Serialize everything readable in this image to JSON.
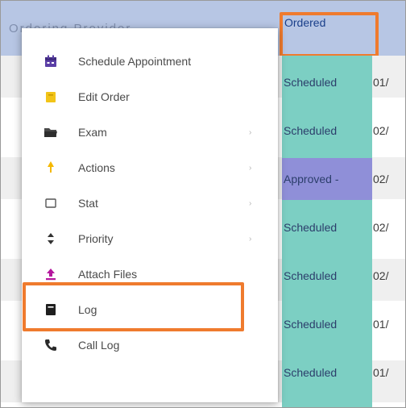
{
  "table": {
    "header_left_text": "Ordering Provider",
    "header_ordered": "Ordered",
    "rows": [
      {
        "status": "Scheduled",
        "date": "01/"
      },
      {
        "status": "Scheduled",
        "date": "02/"
      },
      {
        "status": "Approved - ",
        "date": "02/"
      },
      {
        "status": "Scheduled",
        "date": "02/"
      },
      {
        "status": "Scheduled",
        "date": "02/"
      },
      {
        "status": "Scheduled",
        "date": "01/"
      },
      {
        "status": "Scheduled",
        "date": "01/"
      }
    ]
  },
  "menu": {
    "items": [
      {
        "label": "Schedule Appointment",
        "icon": "calendar-icon",
        "has_submenu": false
      },
      {
        "label": "Edit Order",
        "icon": "folder-icon",
        "has_submenu": false
      },
      {
        "label": "Exam",
        "icon": "folder-open-icon",
        "has_submenu": true
      },
      {
        "label": "Actions",
        "icon": "lightbulb-icon",
        "has_submenu": true
      },
      {
        "label": "Stat",
        "icon": "square-icon",
        "has_submenu": true
      },
      {
        "label": "Priority",
        "icon": "sort-icon",
        "has_submenu": true
      },
      {
        "label": "Attach Files",
        "icon": "upload-icon",
        "has_submenu": false
      },
      {
        "label": "Log",
        "icon": "book-icon",
        "has_submenu": false
      },
      {
        "label": "Call Log",
        "icon": "phone-icon",
        "has_submenu": false
      }
    ],
    "submenu_arrow": "›"
  },
  "colors": {
    "header_bg": "#b7c6e4",
    "status_teal": "#7ccfc3",
    "status_approved": "#8f8fd8",
    "highlight_orange": "#ef7b2e"
  }
}
